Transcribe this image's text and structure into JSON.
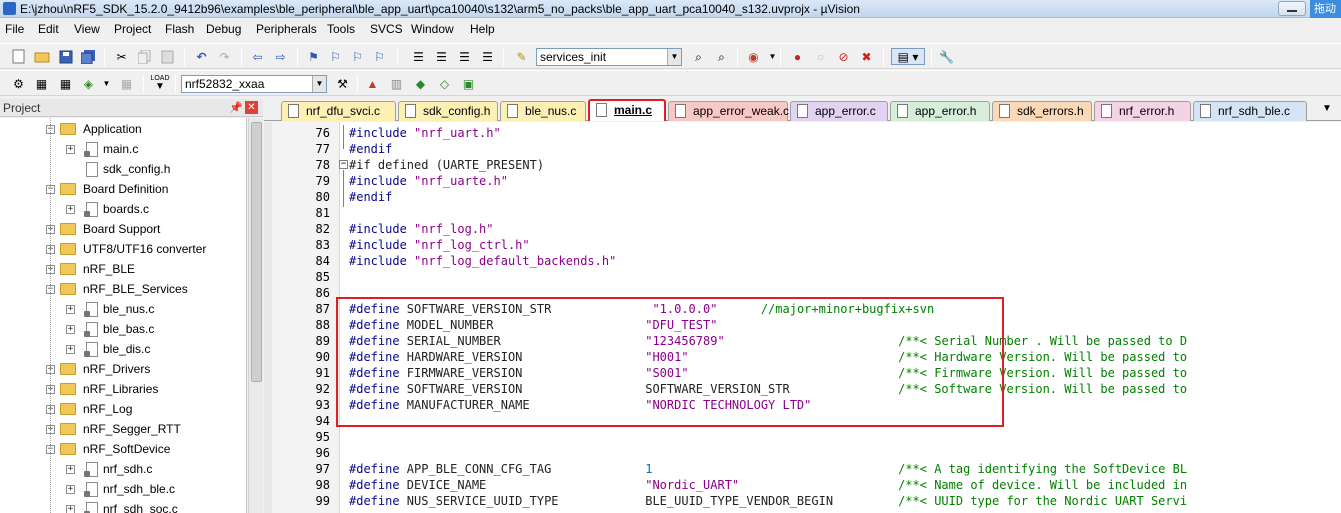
{
  "window": {
    "title": "E:\\jzhou\\nRF5_SDK_15.2.0_9412b96\\examples\\ble_peripheral\\ble_app_uart\\pca10040\\s132\\arm5_no_packs\\ble_app_uart_pca10040_s132.uvprojx - µVision",
    "cloud_label": "拖动"
  },
  "menu": [
    "File",
    "Edit",
    "View",
    "Project",
    "Flash",
    "Debug",
    "Peripherals",
    "Tools",
    "SVCS",
    "Window",
    "Help"
  ],
  "toolbar": {
    "function_combo": "services_init",
    "target_combo": "nrf52832_xxaa",
    "load_label": "LOAD"
  },
  "project_panel": {
    "title": "Project",
    "pin": "ᵖ",
    "tree": [
      {
        "label": "Application",
        "type": "folder",
        "level": 0,
        "expanded": true
      },
      {
        "label": "main.c",
        "type": "file",
        "level": 1,
        "expandable": true
      },
      {
        "label": "sdk_config.h",
        "type": "file",
        "level": 1,
        "expandable": false
      },
      {
        "label": "Board Definition",
        "type": "folder",
        "level": 0,
        "expanded": true
      },
      {
        "label": "boards.c",
        "type": "file",
        "level": 1,
        "expandable": true
      },
      {
        "label": "Board Support",
        "type": "folder",
        "level": 0,
        "expanded": false
      },
      {
        "label": "UTF8/UTF16 converter",
        "type": "folder",
        "level": 0,
        "expanded": false
      },
      {
        "label": "nRF_BLE",
        "type": "folder",
        "level": 0,
        "expanded": false
      },
      {
        "label": "nRF_BLE_Services",
        "type": "folder",
        "level": 0,
        "expanded": true
      },
      {
        "label": "ble_nus.c",
        "type": "file",
        "level": 1,
        "expandable": true
      },
      {
        "label": "ble_bas.c",
        "type": "file",
        "level": 1,
        "expandable": true
      },
      {
        "label": "ble_dis.c",
        "type": "file",
        "level": 1,
        "expandable": true
      },
      {
        "label": "nRF_Drivers",
        "type": "folder",
        "level": 0,
        "expanded": false
      },
      {
        "label": "nRF_Libraries",
        "type": "folder",
        "level": 0,
        "expanded": false
      },
      {
        "label": "nRF_Log",
        "type": "folder",
        "level": 0,
        "expanded": false
      },
      {
        "label": "nRF_Segger_RTT",
        "type": "folder",
        "level": 0,
        "expanded": false
      },
      {
        "label": "nRF_SoftDevice",
        "type": "folder",
        "level": 0,
        "expanded": true
      },
      {
        "label": "nrf_sdh.c",
        "type": "file",
        "level": 1,
        "expandable": true
      },
      {
        "label": "nrf_sdh_ble.c",
        "type": "file",
        "level": 1,
        "expandable": true
      },
      {
        "label": "nrf_sdh_soc.c",
        "type": "file",
        "level": 1,
        "expandable": true
      }
    ]
  },
  "tabs": [
    {
      "label": "nrf_dfu_svci.c",
      "color": "#fdf0b4",
      "active": false
    },
    {
      "label": "sdk_config.h",
      "color": "#fdf0b4",
      "active": false
    },
    {
      "label": "ble_nus.c",
      "color": "#fdf0b4",
      "active": false
    },
    {
      "label": "main.c",
      "color": "#ffffff",
      "active": true
    },
    {
      "label": "app_error_weak.c",
      "color": "#f8c9c4",
      "active": false
    },
    {
      "label": "app_error.c",
      "color": "#e3d3f3",
      "active": false
    },
    {
      "label": "app_error.h",
      "color": "#d5eed7",
      "active": false
    },
    {
      "label": "sdk_errors.h",
      "color": "#fbd8b6",
      "active": false
    },
    {
      "label": "nrf_error.h",
      "color": "#f4d3e4",
      "active": false
    },
    {
      "label": "nrf_sdh_ble.c",
      "color": "#d5e4f5",
      "active": false
    }
  ],
  "editor": {
    "lines": [
      {
        "n": "76",
        "parts": [
          {
            "t": "#include ",
            "c": "pp"
          },
          {
            "t": "\"nrf_uart.h\"",
            "c": "str"
          }
        ]
      },
      {
        "n": "77",
        "parts": [
          {
            "t": "#endif",
            "c": "pp"
          }
        ]
      },
      {
        "n": "78",
        "parts": [
          {
            "t": "#if defined (UARTE_PRESENT)",
            "c": "kw"
          }
        ]
      },
      {
        "n": "79",
        "parts": [
          {
            "t": "#include ",
            "c": "pp"
          },
          {
            "t": "\"nrf_uarte.h\"",
            "c": "str"
          }
        ]
      },
      {
        "n": "80",
        "parts": [
          {
            "t": "#endif",
            "c": "pp"
          }
        ]
      },
      {
        "n": "81",
        "parts": []
      },
      {
        "n": "82",
        "parts": [
          {
            "t": "#include ",
            "c": "pp"
          },
          {
            "t": "\"nrf_log.h\"",
            "c": "str"
          }
        ]
      },
      {
        "n": "83",
        "parts": [
          {
            "t": "#include ",
            "c": "pp"
          },
          {
            "t": "\"nrf_log_ctrl.h\"",
            "c": "str"
          }
        ]
      },
      {
        "n": "84",
        "parts": [
          {
            "t": "#include ",
            "c": "pp"
          },
          {
            "t": "\"nrf_log_default_backends.h\"",
            "c": "str"
          }
        ]
      },
      {
        "n": "85",
        "parts": []
      },
      {
        "n": "86",
        "parts": []
      },
      {
        "n": "87",
        "parts": [
          {
            "t": "#define ",
            "c": "pp"
          },
          {
            "t": "SOFTWARE_VERSION_STR              ",
            "c": "kw"
          },
          {
            "t": "\"1.0.0.0\"",
            "c": "str"
          },
          {
            "t": "      //major+minor+bugfix+svn",
            "c": "cm"
          }
        ]
      },
      {
        "n": "88",
        "parts": [
          {
            "t": "#define ",
            "c": "pp"
          },
          {
            "t": "MODEL_NUMBER                     ",
            "c": "kw"
          },
          {
            "t": "\"DFU_TEST\"",
            "c": "str"
          }
        ]
      },
      {
        "n": "89",
        "parts": [
          {
            "t": "#define ",
            "c": "pp"
          },
          {
            "t": "SERIAL_NUMBER                    ",
            "c": "kw"
          },
          {
            "t": "\"123456789\"",
            "c": "str"
          },
          {
            "t": "                        /**< Serial Number . Will be passed to D",
            "c": "cm"
          }
        ]
      },
      {
        "n": "90",
        "parts": [
          {
            "t": "#define ",
            "c": "pp"
          },
          {
            "t": "HARDWARE_VERSION                 ",
            "c": "kw"
          },
          {
            "t": "\"H001\"",
            "c": "str"
          },
          {
            "t": "                             /**< Hardware Version. Will be passed to",
            "c": "cm"
          }
        ]
      },
      {
        "n": "91",
        "parts": [
          {
            "t": "#define ",
            "c": "pp"
          },
          {
            "t": "FIRMWARE_VERSION                 ",
            "c": "kw"
          },
          {
            "t": "\"S001\"",
            "c": "str"
          },
          {
            "t": "                             /**< Firmware Version. Will be passed to",
            "c": "cm"
          }
        ]
      },
      {
        "n": "92",
        "parts": [
          {
            "t": "#define ",
            "c": "pp"
          },
          {
            "t": "SOFTWARE_VERSION                 ",
            "c": "kw"
          },
          {
            "t": "SOFTWARE_VERSION_STR",
            "c": "kw"
          },
          {
            "t": "               /**< Software Version. Will be passed to",
            "c": "cm"
          }
        ]
      },
      {
        "n": "93",
        "parts": [
          {
            "t": "#define ",
            "c": "pp"
          },
          {
            "t": "MANUFACTURER_NAME                ",
            "c": "kw"
          },
          {
            "t": "\"NORDIC TECHNOLOGY LTD\"",
            "c": "str"
          }
        ]
      },
      {
        "n": "94",
        "parts": []
      },
      {
        "n": "95",
        "parts": []
      },
      {
        "n": "96",
        "parts": []
      },
      {
        "n": "97",
        "parts": [
          {
            "t": "#define ",
            "c": "pp"
          },
          {
            "t": "APP_BLE_CONN_CFG_TAG             ",
            "c": "kw"
          },
          {
            "t": "1",
            "c": "num"
          },
          {
            "t": "                                  /**< A tag identifying the SoftDevice BL",
            "c": "cm"
          }
        ]
      },
      {
        "n": "98",
        "parts": [
          {
            "t": "#define ",
            "c": "pp"
          },
          {
            "t": "DEVICE_NAME                      ",
            "c": "kw"
          },
          {
            "t": "\"Nordic_UART\"",
            "c": "str"
          },
          {
            "t": "                      /**< Name of device. Will be included in",
            "c": "cm"
          }
        ]
      },
      {
        "n": "99",
        "parts": [
          {
            "t": "#define ",
            "c": "pp"
          },
          {
            "t": "NUS_SERVICE_UUID_TYPE            ",
            "c": "kw"
          },
          {
            "t": "BLE_UUID_TYPE_VENDOR_BEGIN",
            "c": "kw"
          },
          {
            "t": "         /**< UUID type for the Nordic UART Servi",
            "c": "cm"
          }
        ]
      }
    ]
  }
}
